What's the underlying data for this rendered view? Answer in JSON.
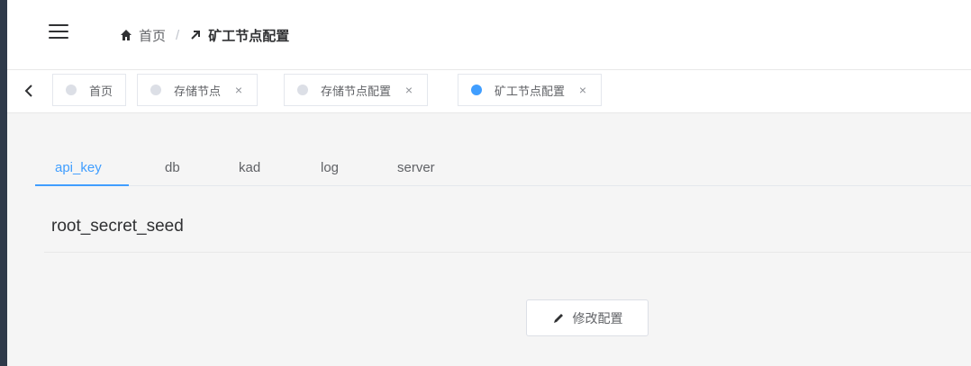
{
  "header": {
    "breadcrumb": {
      "home_label": "首页",
      "separator": "/",
      "current_label": "矿工节点配置"
    }
  },
  "tags": {
    "items": [
      {
        "label": "首页",
        "active": false,
        "closable": false
      },
      {
        "label": "存储节点",
        "active": false,
        "closable": true
      },
      {
        "label": "存储节点配置",
        "active": false,
        "closable": true
      },
      {
        "label": "矿工节点配置",
        "active": true,
        "closable": true
      }
    ],
    "close_glyph": "×"
  },
  "tabs": {
    "items": [
      "api_key",
      "db",
      "kad",
      "log",
      "server"
    ],
    "active": "api_key"
  },
  "section": {
    "title": "root_secret_seed"
  },
  "actions": {
    "edit_label": "修改配置"
  },
  "colors": {
    "accent": "#409eff",
    "sidebar": "#2f3a4a",
    "background": "#f5f5f5"
  }
}
